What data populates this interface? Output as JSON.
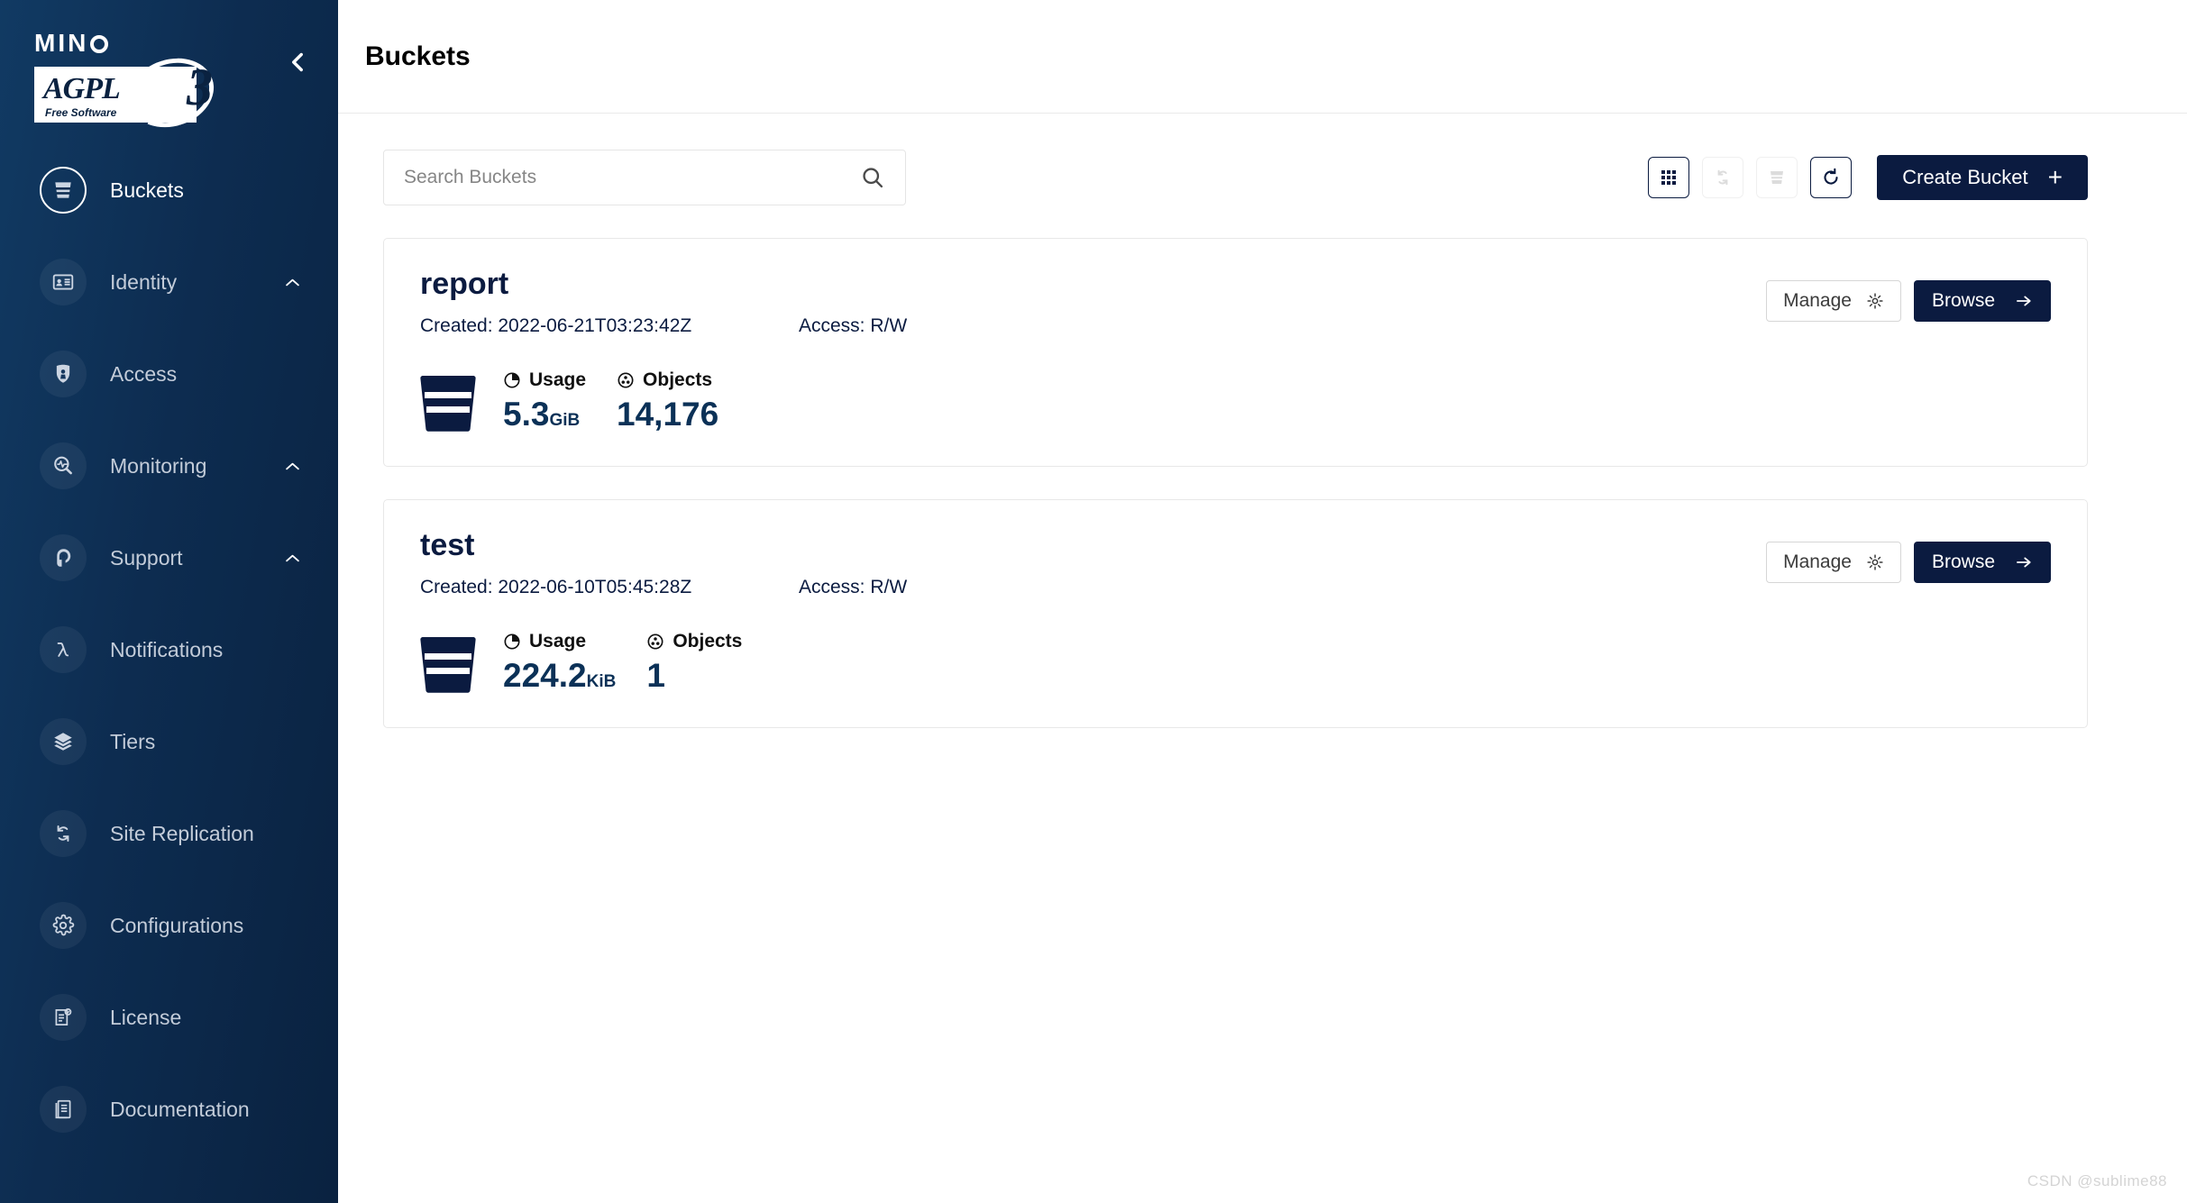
{
  "sidebar": {
    "brand": {
      "name": "MINIO",
      "license_badge": "AGPL",
      "license_version": "3",
      "license_sub": "Free Software"
    },
    "collapse_icon": "chevron-left-icon",
    "items": [
      {
        "label": "Buckets",
        "icon": "bucket-icon",
        "active": true,
        "expandable": false
      },
      {
        "label": "Identity",
        "icon": "identity-card-icon",
        "active": false,
        "expandable": true
      },
      {
        "label": "Access",
        "icon": "lock-icon",
        "active": false,
        "expandable": false
      },
      {
        "label": "Monitoring",
        "icon": "magnifier-pulse-icon",
        "active": false,
        "expandable": true
      },
      {
        "label": "Support",
        "icon": "headset-icon",
        "active": false,
        "expandable": true
      },
      {
        "label": "Notifications",
        "icon": "lambda-icon",
        "active": false,
        "expandable": false
      },
      {
        "label": "Tiers",
        "icon": "layers-icon",
        "active": false,
        "expandable": false
      },
      {
        "label": "Site Replication",
        "icon": "sync-arrows-icon",
        "active": false,
        "expandable": false
      },
      {
        "label": "Configurations",
        "icon": "gear-icon",
        "active": false,
        "expandable": false
      },
      {
        "label": "License",
        "icon": "certificate-icon",
        "active": false,
        "expandable": false
      },
      {
        "label": "Documentation",
        "icon": "book-icon",
        "active": false,
        "expandable": false
      }
    ]
  },
  "header": {
    "title": "Buckets"
  },
  "toolbar": {
    "search_placeholder": "Search Buckets",
    "search_value": "",
    "search_icon": "search-icon",
    "buttons": [
      {
        "name": "grid-view-button",
        "icon": "grid-icon",
        "enabled": true
      },
      {
        "name": "replication-button",
        "icon": "sync-icon",
        "enabled": false
      },
      {
        "name": "delete-buckets-button",
        "icon": "bucket-icon",
        "enabled": false
      },
      {
        "name": "refresh-button",
        "icon": "refresh-icon",
        "enabled": true
      }
    ],
    "create_label": "Create Bucket",
    "create_plus": "+"
  },
  "buckets": [
    {
      "name": "report",
      "created_label": "Created: 2022-06-21T03:23:42Z",
      "access_label": "Access: R/W",
      "usage_label": "Usage",
      "usage_value": "5.3",
      "usage_unit": "GiB",
      "objects_label": "Objects",
      "objects_value": "14,176",
      "manage_label": "Manage",
      "browse_label": "Browse"
    },
    {
      "name": "test",
      "created_label": "Created: 2022-06-10T05:45:28Z",
      "access_label": "Access: R/W",
      "usage_label": "Usage",
      "usage_value": "224.2",
      "usage_unit": "KiB",
      "objects_label": "Objects",
      "objects_value": "1",
      "manage_label": "Manage",
      "browse_label": "Browse"
    }
  ],
  "watermark": "CSDN @sublime88",
  "colors": {
    "sidebar_navy": "#0d2c50",
    "primary_dark": "#0b1b40",
    "stat_value": "#0b3157",
    "card_border": "#e8e8e8"
  }
}
